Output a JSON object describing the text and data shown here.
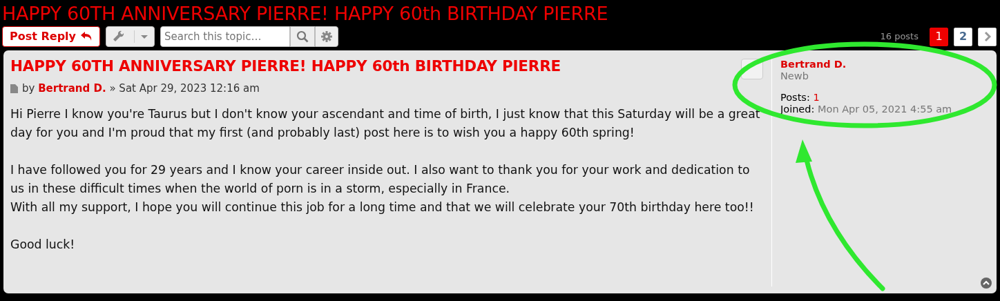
{
  "topic_title": "HAPPY 60TH ANNIVERSARY PIERRE! HAPPY 60th BIRTHDAY PIERRE",
  "action_bar": {
    "reply_button": "Post Reply",
    "search": {
      "placeholder": "Search this topic…"
    },
    "post_count": "16 posts",
    "pages": [
      {
        "label": "1",
        "selected": true
      },
      {
        "label": "2",
        "selected": false
      }
    ]
  },
  "post": {
    "title": "HAPPY 60TH ANNIVERSARY PIERRE! HAPPY 60th BIRTHDAY PIERRE",
    "by": "by",
    "author": "Bertrand D.",
    "date": "» Sat Apr 29, 2023 12:16 am",
    "paragraphs": [
      "Hi Pierre I know you're Taurus but I don't know your ascendant and time of birth, I just know that this Saturday will be a great day for you and I'm proud that my first (and probably last) post here is to wish you a happy 60th spring!",
      "I have followed you for 29 years and I know your career inside out. I also want to thank you for your work and dedication to us in these difficult times when the world of porn is in a storm, especially in France.\nWith all my support, I hope you will continue this job for a long time and that we will celebrate your 70th birthday here too!!",
      "Good luck!"
    ]
  },
  "profile": {
    "username": "Bertrand D.",
    "rank": "Newb",
    "posts_label": "Posts:",
    "posts": "1",
    "joined_label": "Joined:",
    "joined": "Mon Apr 05, 2021 4:55 am"
  }
}
